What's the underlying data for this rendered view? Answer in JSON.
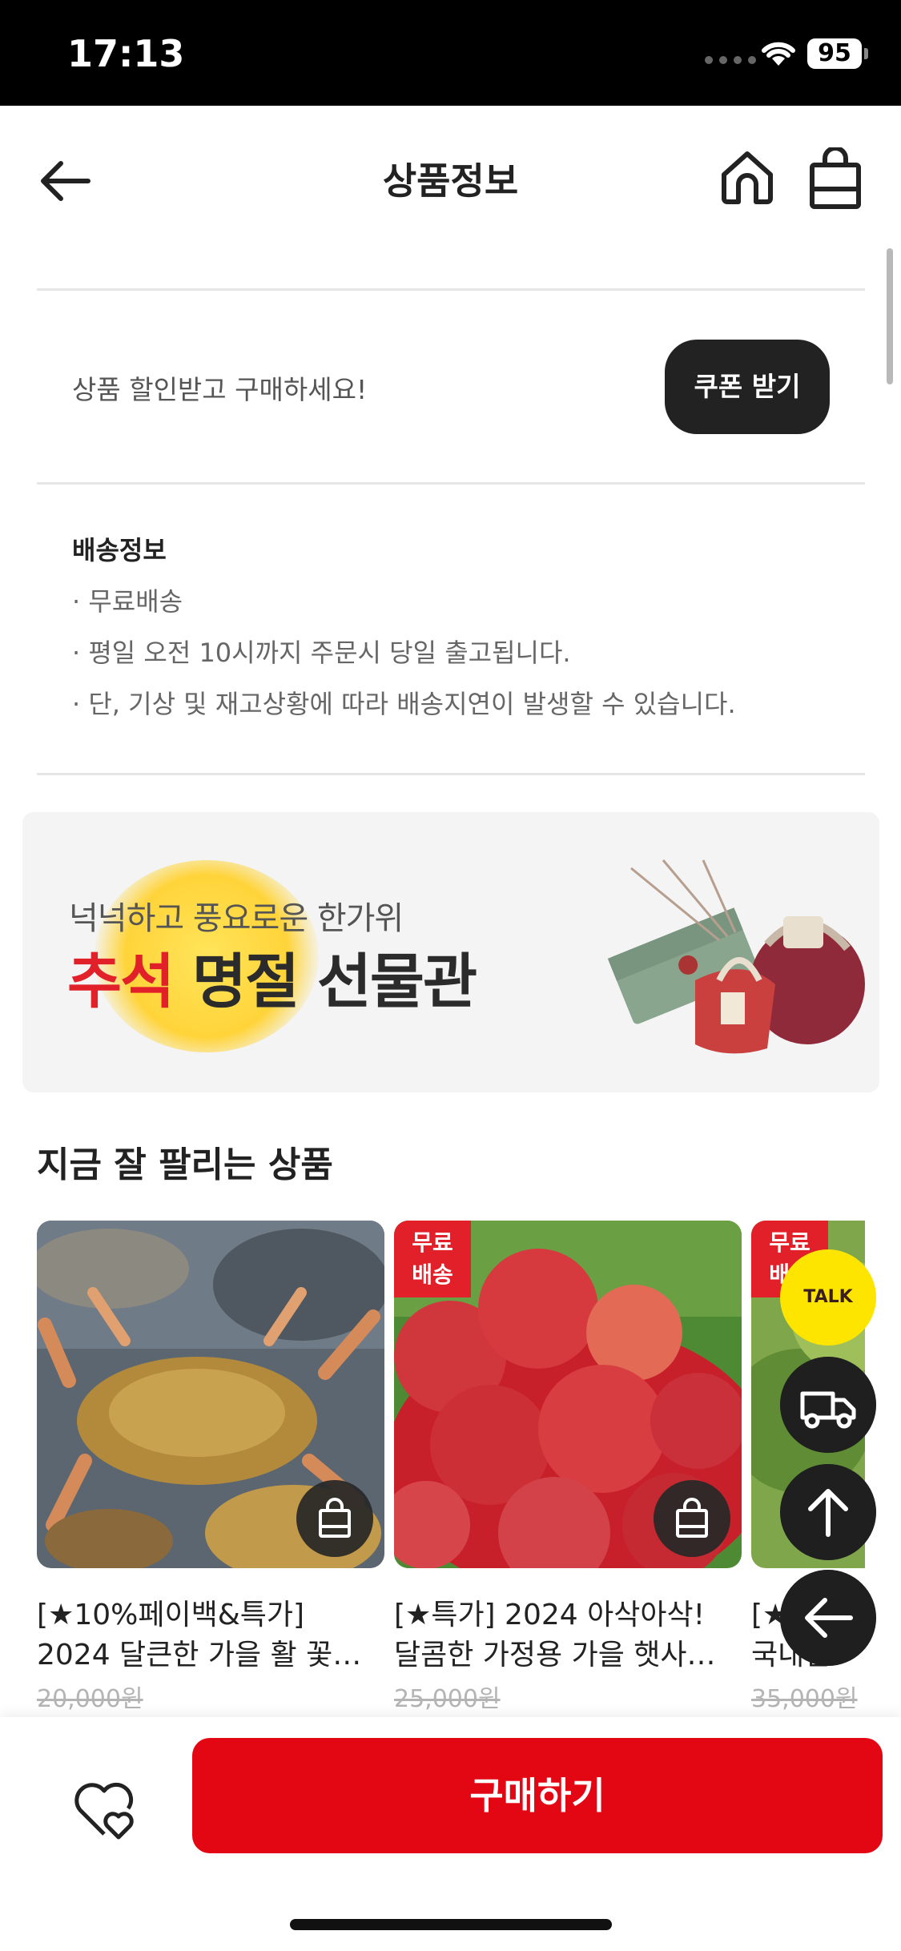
{
  "status_bar": {
    "time": "17:13",
    "battery": "95"
  },
  "header": {
    "title": "상품정보",
    "icons": {
      "back": "arrow-left-icon",
      "home": "home-icon",
      "cart": "shopping-bag-icon"
    }
  },
  "coupon": {
    "text": "상품 할인받고 구매하세요!",
    "button": "쿠폰 받기"
  },
  "shipping": {
    "title": "배송정보",
    "lines": [
      "· 무료배송",
      "· 평일 오전 10시까지 주문시 당일 출고됩니다.",
      "· 단, 기상 및 재고상황에 따라 배송지연이 발생할 수 있습니다."
    ]
  },
  "banner": {
    "subtitle": "넉넉하고 풍요로운 한가위",
    "title_accent": "추석",
    "title_rest": " 명절 선물관"
  },
  "best": {
    "title": "지금 잘 팔리는 상품",
    "products": [
      {
        "line1": "[★10%페이백&특가]",
        "line2": "2024 달큰한 가을 활 꽃…",
        "price": "20,000원",
        "badge": ""
      },
      {
        "line1": "[★특가] 2024 아삭아삭!",
        "line2": "달콤한 가정용 가을 햇사…",
        "price": "25,000원",
        "badge": "무료\n배송"
      },
      {
        "line1": "[★",
        "line2": "국내산",
        "price": "35,000원",
        "badge": "무료\n배송"
      }
    ]
  },
  "floating": {
    "talk_label": "TALK"
  },
  "bottom_bar": {
    "buy_label": "구매하기"
  },
  "colors": {
    "accent": "#e30613",
    "dark_button": "#222222",
    "kakao_yellow": "#fee500"
  }
}
